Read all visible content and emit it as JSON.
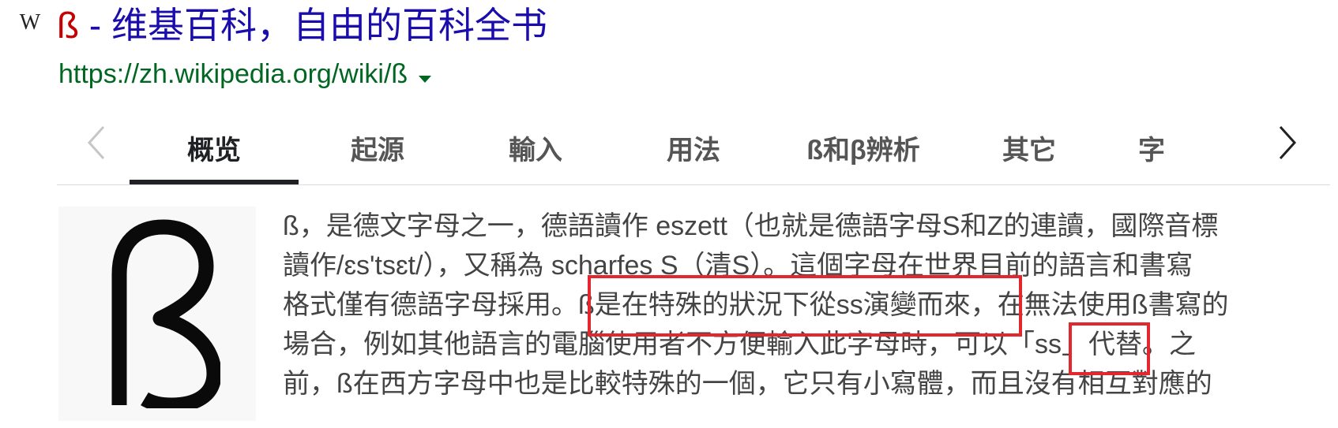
{
  "result": {
    "favicon_glyph": "W",
    "title_eszett": "ß",
    "title_text": " - 维基百科，自由的百科全书",
    "url": "https://zh.wikipedia.org/wiki/ß"
  },
  "tabs": [
    {
      "label": "概览",
      "active": true
    },
    {
      "label": "起源"
    },
    {
      "label": "輸入"
    },
    {
      "label": "用法"
    },
    {
      "label": "ß和β辨析"
    },
    {
      "label": "其它"
    },
    {
      "label": "字"
    }
  ],
  "thumbnail": {
    "glyph": "ß"
  },
  "snippet": {
    "line1": "ß，是德文字母之一，德語讀作 eszett（也就是德語字母S和Z的連讀，國際音標",
    "line2": "讀作/ɛs'tsɛt/），又稱為 scharfes S（清S）。這個字母在世界目前的語言和書寫",
    "line3_a": "格式僅有德語字母採用。",
    "line3_b": "ß是在特殊的狀況下從ss演變而來",
    "line3_c": "，在無法使用ß書寫的",
    "line4_a": "場合，例如其他語言的電腦使用者不方便輸入此字母時，可以",
    "line4_b": "「ss」",
    "line4_c": "代替。之",
    "line5": "前，ß在西方字母中也是比較特殊的一個，它只有小寫體，而且沒有相互對應的"
  },
  "colors": {
    "title_link": "#1a0dab",
    "title_eszett": "#c40000",
    "url": "#006621",
    "highlight_box": "#e2282e"
  },
  "icons": [
    "wikipedia-icon",
    "chevron-left-icon",
    "chevron-right-icon",
    "dropdown-caret-icon"
  ]
}
